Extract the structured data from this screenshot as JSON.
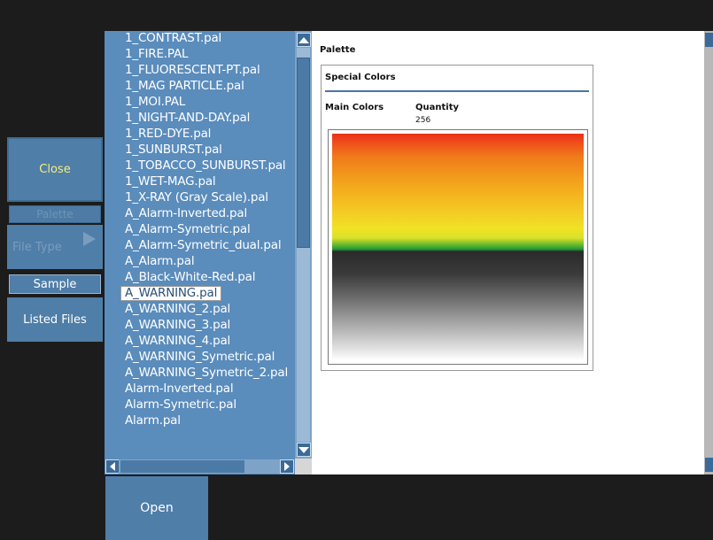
{
  "left_panel": {
    "close_label": "Close",
    "palette_label": "Palette",
    "file_type_label": "File Type",
    "sample_label": "Sample",
    "listed_files_label": "Listed Files"
  },
  "file_list": {
    "items": [
      "1_CONTRAST.pal",
      "1_FIRE.PAL",
      "1_FLUORESCENT-PT.pal",
      "1_MAG PARTICLE.pal",
      "1_MOI.PAL",
      "1_NIGHT-AND-DAY.pal",
      "1_RED-DYE.pal",
      "1_SUNBURST.pal",
      "1_TOBACCO_SUNBURST.pal",
      "1_WET-MAG.pal",
      "1_X-RAY (Gray Scale).pal",
      "A_Alarm-Inverted.pal",
      "A_Alarm-Symetric.pal",
      "A_Alarm-Symetric_dual.pal",
      "A_Alarm.pal",
      "A_Black-White-Red.pal",
      "A_WARNING.pal",
      "A_WARNING_2.pal",
      "A_WARNING_3.pal",
      "A_WARNING_4.pal",
      "A_WARNING_Symetric.pal",
      "A_WARNING_Symetric_2.pal",
      "Alarm-Inverted.pal",
      "Alarm-Symetric.pal",
      "Alarm.pal"
    ],
    "selected": "A_WARNING.pal"
  },
  "preview": {
    "title": "Palette",
    "section_title": "Special Colors",
    "main_colors_label": "Main Colors",
    "quantity_label": "Quantity",
    "quantity_value": "256"
  },
  "bottom": {
    "open_label": "Open"
  },
  "colors": {
    "panel_blue": "#4f7ea8",
    "list_blue": "#5a8cbc",
    "background": "#1c1c1c"
  }
}
